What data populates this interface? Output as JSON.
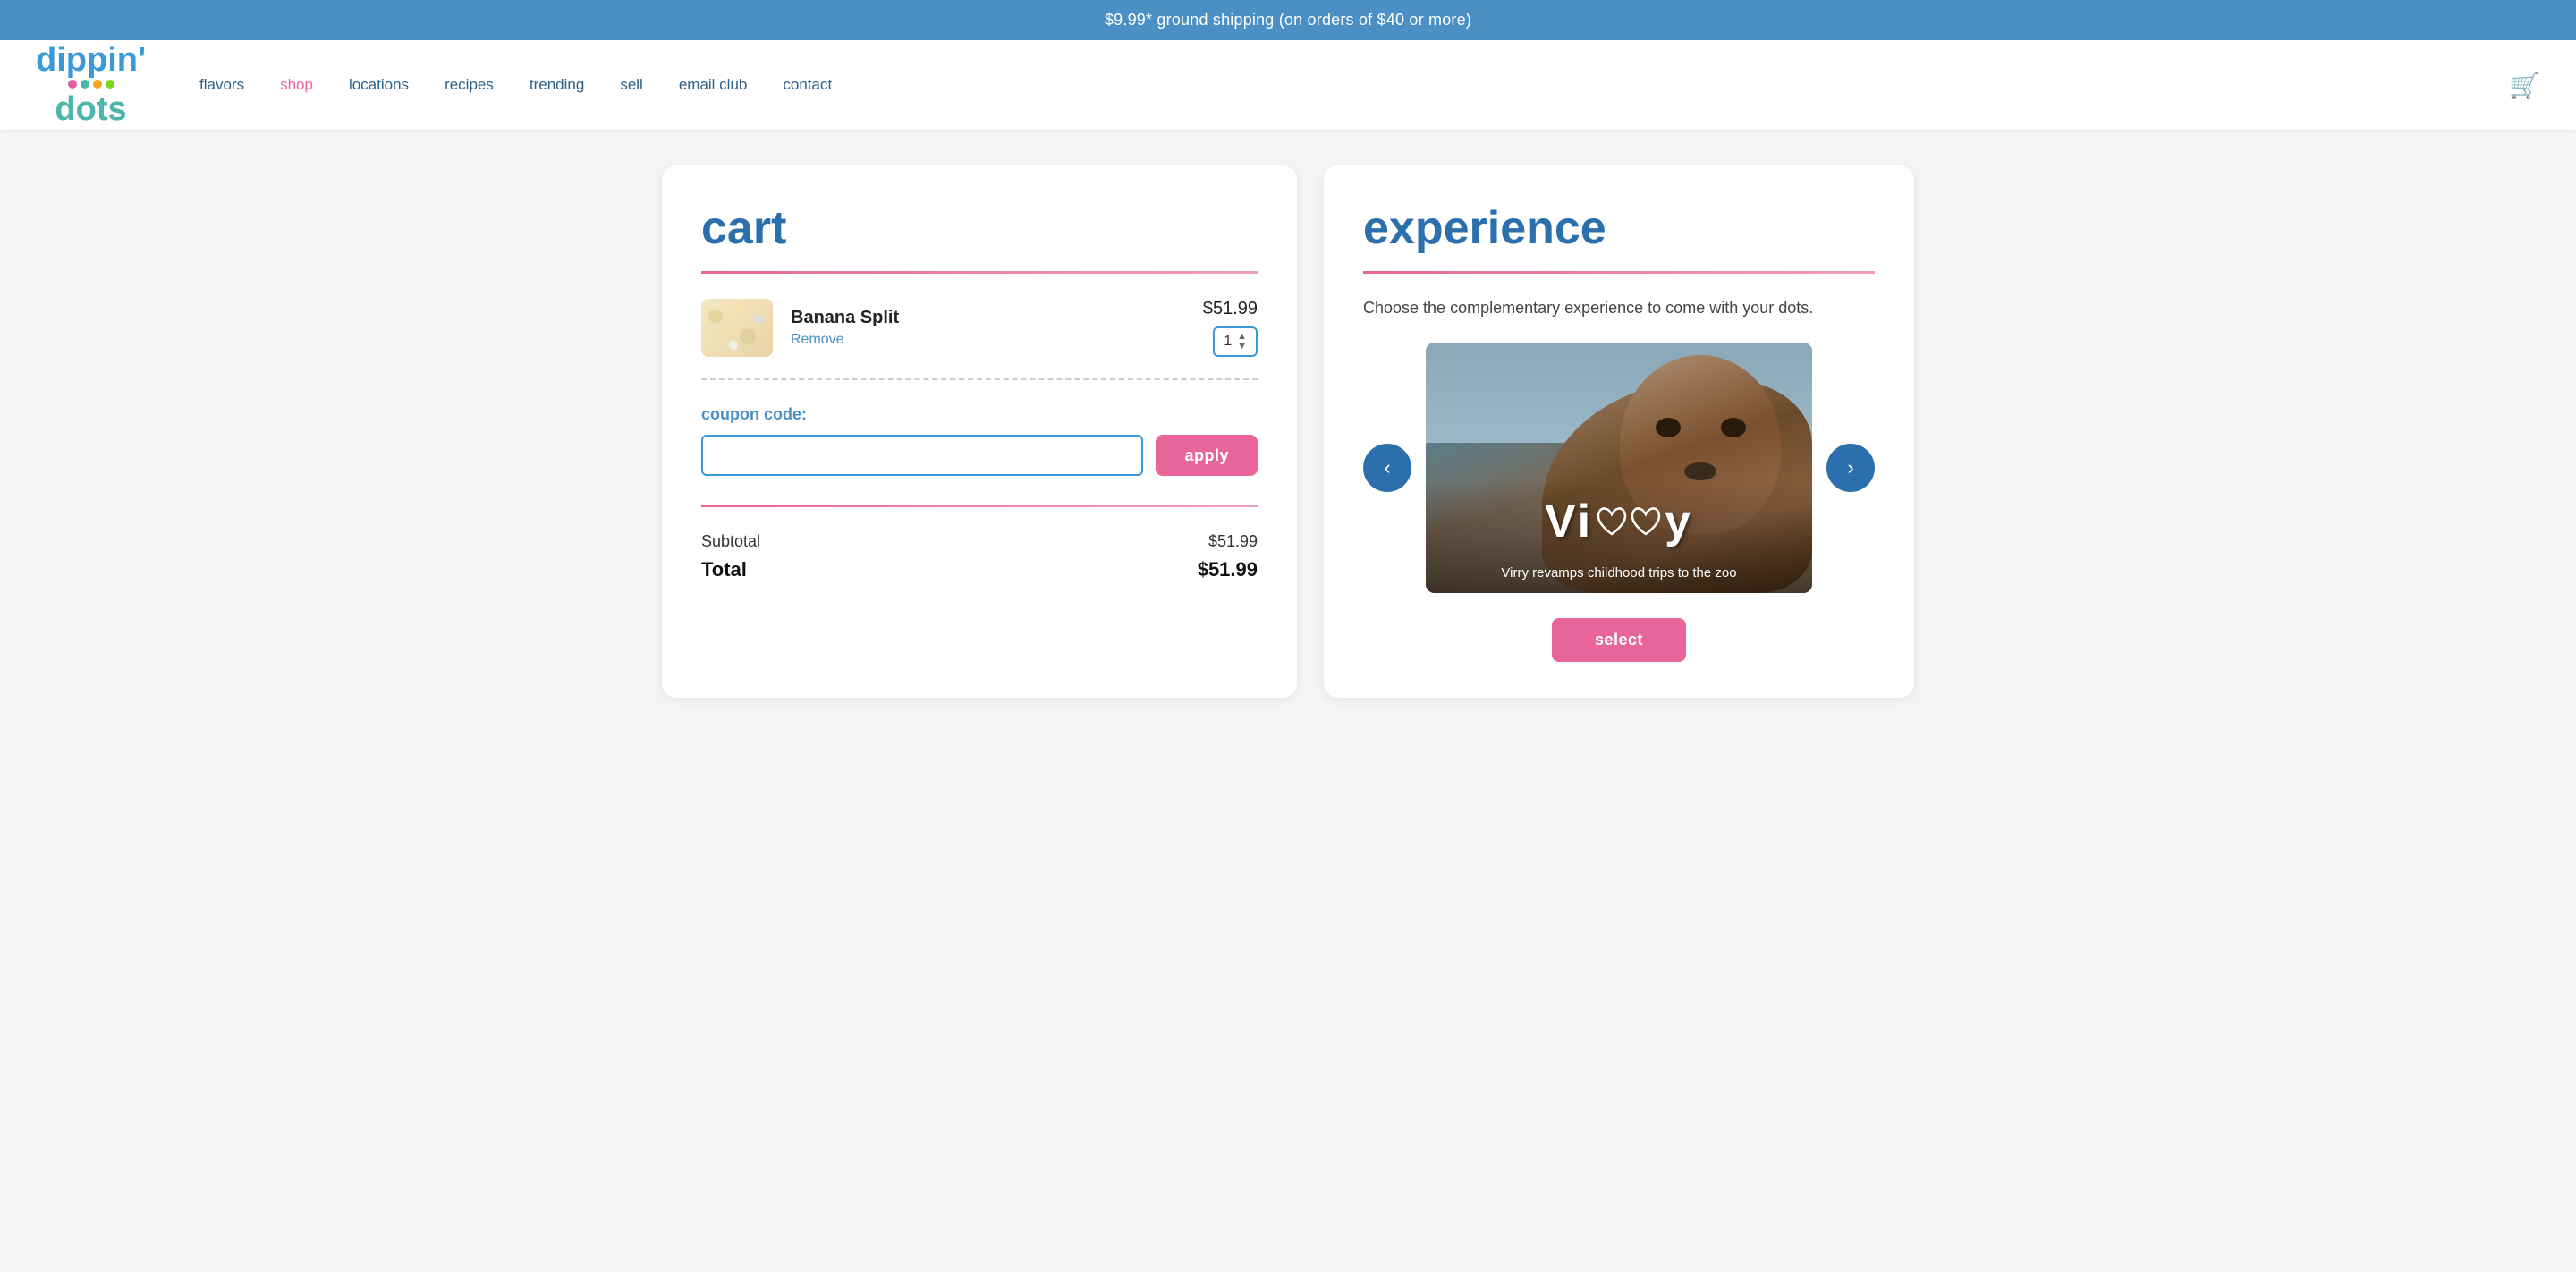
{
  "banner": {
    "text": "$9.99* ground shipping (on orders of $40 or more)"
  },
  "nav": {
    "logo_line1": "dippin'",
    "logo_line2": "dots",
    "links": [
      {
        "id": "flavors",
        "label": "flavors",
        "active": false
      },
      {
        "id": "shop",
        "label": "shop",
        "active": true
      },
      {
        "id": "locations",
        "label": "locations",
        "active": false
      },
      {
        "id": "recipes",
        "label": "recipes",
        "active": false
      },
      {
        "id": "trending",
        "label": "trending",
        "active": false
      },
      {
        "id": "sell",
        "label": "sell",
        "active": false
      },
      {
        "id": "email-club",
        "label": "email club",
        "active": false
      },
      {
        "id": "contact",
        "label": "contact",
        "active": false
      }
    ]
  },
  "cart": {
    "title": "cart",
    "item": {
      "name": "Banana Split",
      "remove_label": "Remove",
      "price": "$51.99",
      "quantity": "1"
    },
    "coupon": {
      "label": "coupon code:",
      "placeholder": "",
      "apply_label": "apply"
    },
    "subtotal_label": "Subtotal",
    "subtotal_value": "$51.99",
    "total_label": "Total",
    "total_value": "$51.99"
  },
  "experience": {
    "title": "experience",
    "subtitle": "Choose the complementary experience to come with your dots.",
    "prev_label": "‹",
    "next_label": "›",
    "item": {
      "name": "Virry",
      "logo_text_parts": [
        "Vi",
        "❤❤",
        "y"
      ],
      "caption": "Virry revamps childhood trips to the zoo"
    },
    "select_label": "select"
  },
  "colors": {
    "blue": "#2c6fad",
    "pink": "#e8659a",
    "teal": "#4db6ac",
    "light_blue": "#4a90c4"
  }
}
